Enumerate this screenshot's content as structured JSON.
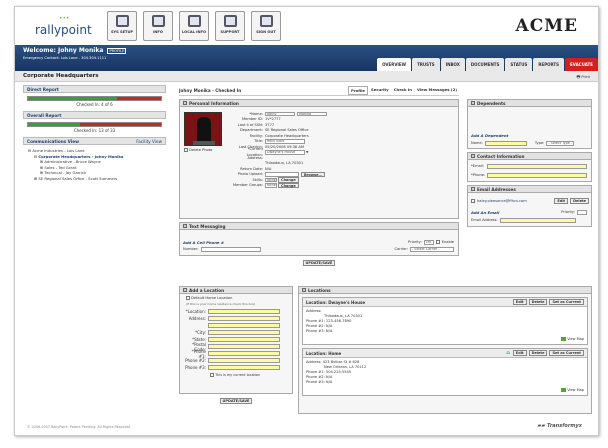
{
  "brand": {
    "logo": "rallypoint",
    "company": "ACME"
  },
  "topnav": [
    {
      "label": "SYS SETUP"
    },
    {
      "label": "INFO"
    },
    {
      "label": "LOCAL INFO"
    },
    {
      "label": "SUPPORT"
    },
    {
      "label": "SIGN OUT"
    }
  ],
  "header": {
    "welcome": "Welcome: Johny Monika",
    "profile": "PROFILE",
    "emergency": "Emergency Contact: Lois Lane - 304.304.1111"
  },
  "tabs": [
    "OVERVIEW",
    "TRUSTS",
    "INBOX",
    "DOCUMENTS",
    "STATUS",
    "REPORTS",
    "EVACUATE"
  ],
  "page": {
    "title": "Corporate Headquarters",
    "print": "Print"
  },
  "left": {
    "direct_report": {
      "title": "Direct Report",
      "checked": "Checked In: 4 of 6",
      "fill": 0.67
    },
    "overall_report": {
      "title": "Overall Report",
      "checked": "Checked In: 13 of 33",
      "fill": 0.39
    },
    "comm": {
      "title": "Communications View",
      "link": "Facility View"
    },
    "tree": [
      {
        "label": "Acme Industries - Lois Lane"
      },
      {
        "label": "Corporate Headquarters - Johny Monika"
      },
      {
        "label": "Administrative - Bruce Wayne"
      },
      {
        "label": "Sales - Ted Grant"
      },
      {
        "label": "Technical - Jay Garrick"
      },
      {
        "label": "SE Regional Sales Office - Scott Summers"
      }
    ]
  },
  "content": {
    "title": "Johny Monika - Checked In",
    "rtabs": [
      "Profile",
      "Security",
      "Check In",
      "View Messages (2)"
    ],
    "personal": {
      "title": "Personal Information",
      "delete_photo": "Delete Photo",
      "fields": [
        {
          "label": "*Name:",
          "value": "Johny",
          "value2": "Monika"
        },
        {
          "label": "Member ID:",
          "value": "1V*2777"
        },
        {
          "label": "Last 4 of SSN:",
          "value": "3777"
        },
        {
          "label": "Department:",
          "value": "SE Regional Sales Office"
        },
        {
          "label": "Facility:",
          "value": "Corporate Headquarters"
        },
        {
          "label": "Title:",
          "value": "Rock Solid"
        },
        {
          "label": "Last Checkin:",
          "value": "05/20/2008 09:38 AM"
        },
        {
          "label": "*Current Location:",
          "value": "Dwayne's House"
        }
      ],
      "address_label": "Address:",
      "address": "Thibodaux, LA 70301",
      "return_label": "Return Date:",
      "return": "N/A",
      "upload_label": "Photo Upload:",
      "browse": "Browse...",
      "skills_label": "Skills:",
      "skills": "None",
      "change": "Change",
      "groups_label": "Member Groups:",
      "groups": "None"
    },
    "text_msg": {
      "title": "Text Messaging",
      "add": "Add A Cell Phone #",
      "number_label": "Number:",
      "priority_label": "Priority:",
      "priority": "1st",
      "enable": "Enable",
      "carrier_label": "Carrier:",
      "carrier": "- Select Carrier -"
    },
    "update": "UPDATE/SAVE",
    "add_location": {
      "title": "Add a Location",
      "default": "Default Home Location",
      "hint": "(If this is your home residence check this box)",
      "fields": [
        "*Location:",
        "Address:",
        "*City:",
        "*State:",
        "*Postal Code:",
        "*Phone #1:",
        "Phone #2:",
        "Phone #3:"
      ],
      "current": "This is my current location",
      "save": "UPDATE/SAVE"
    },
    "locations": {
      "title": "Locations",
      "items": [
        {
          "name": "Location: Dwayne's House",
          "address_label": "Address:",
          "address": "Thibodaux, LA 70301",
          "p1": "Phone #1: 123-456-7890",
          "p2": "Phone #2: N/A",
          "p3": "Phone #3: N/A"
        },
        {
          "name": "Location: Home",
          "address_label": "Address:",
          "address": "423 Bulbar St # 628",
          "address2": "New Orleans, LA 70112",
          "p1": "Phone #1: 504.225.5545",
          "p2": "Phone #2: N/A",
          "p3": "Phone #3: N/A"
        }
      ],
      "edit": "Edit",
      "delete": "Delete",
      "set": "Set as Current",
      "map": "View Map"
    }
  },
  "right": {
    "dependents": {
      "title": "Dependents",
      "add": "Add A Dependent",
      "name": "Name:",
      "type": "Type:",
      "type_sel": "- Select Type -"
    },
    "contact": {
      "title": "Contact Information",
      "email": "*Email:",
      "phone": "*Phone:"
    },
    "emails": {
      "title": "Email Addresses",
      "item": "haley.pleasance@ffhcs.com",
      "edit": "Edit",
      "delete": "Delete",
      "add": "Add An Email",
      "priority": "Priority:",
      "addr_label": "Email Address:"
    }
  },
  "footer": {
    "copy": "© 2006-2007 RallyPoint. Patent Pending. All Rights Reserved.",
    "brand": "Transformyx"
  }
}
